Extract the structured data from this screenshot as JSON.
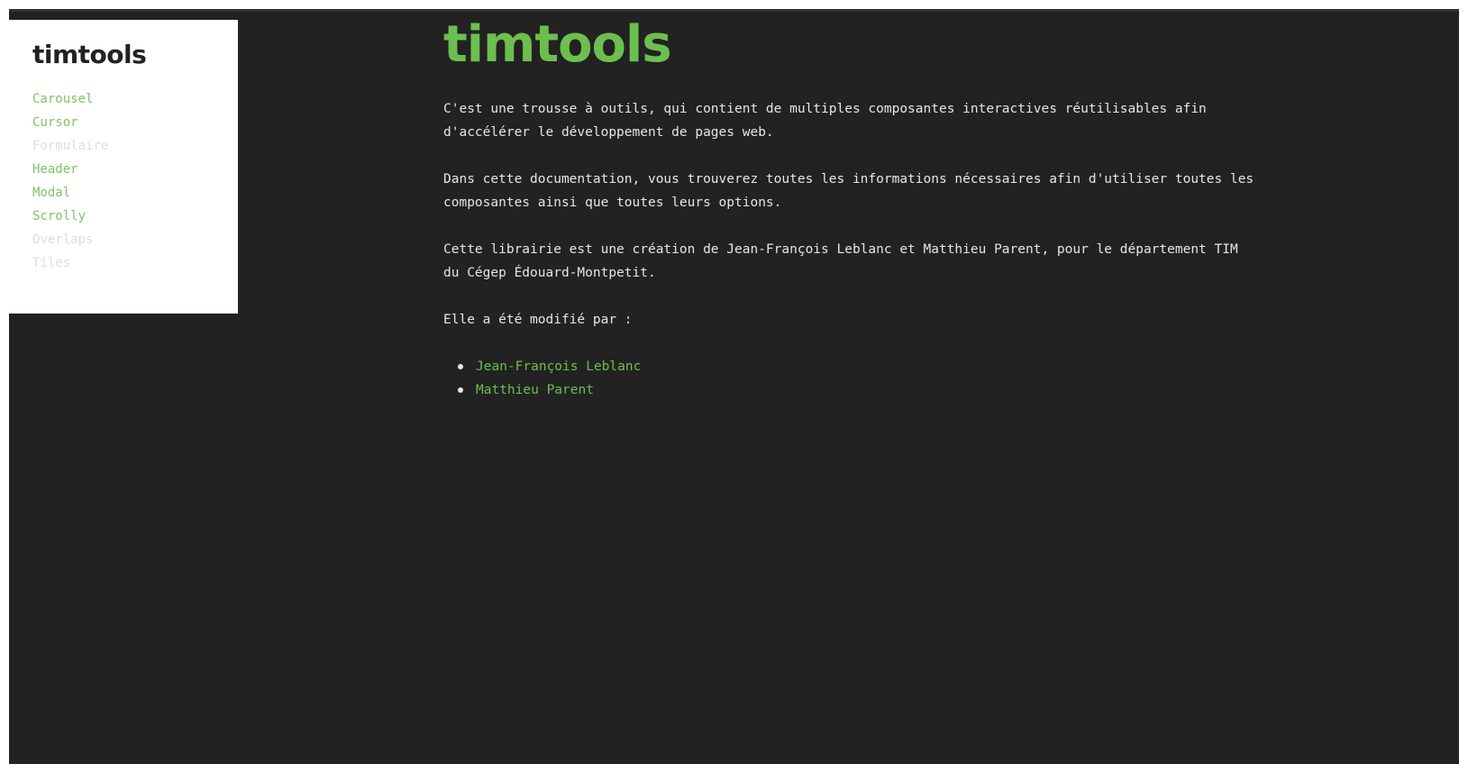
{
  "colors": {
    "background": "#222222",
    "accent": "#6cbf4e",
    "sidebar_bg": "#ffffff",
    "text": "#e6e6e6"
  },
  "sidebar": {
    "logo": "timtools",
    "items": [
      {
        "label": "Carousel"
      },
      {
        "label": "Cursor"
      },
      {
        "label": "Formulaire"
      },
      {
        "label": "Header"
      },
      {
        "label": "Modal"
      },
      {
        "label": "Scrolly"
      },
      {
        "label": "Overlaps"
      },
      {
        "label": "Tiles"
      }
    ]
  },
  "main": {
    "title": "timtools",
    "paragraph1": "C'est une trousse à outils, qui contient de multiples composantes interactives réutilisables afin d'accélérer le développement de pages web.",
    "paragraph2": "Dans cette documentation, vous trouverez toutes les informations nécessaires afin d'utiliser toutes les composantes ainsi que toutes leurs options.",
    "paragraph3": "Cette librairie est une création de Jean-François Leblanc et Matthieu Parent, pour le département TIM du Cégep Édouard-Montpetit.",
    "modified_by": "Elle a été modifié par :",
    "contributors": [
      {
        "name": "Jean-François Leblanc"
      },
      {
        "name": "Matthieu Parent"
      }
    ]
  }
}
